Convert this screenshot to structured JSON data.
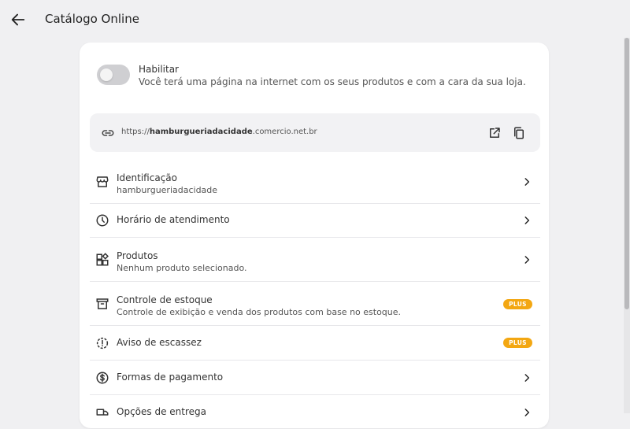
{
  "header": {
    "title": "Catálogo Online",
    "back_icon": "arrow-left-icon"
  },
  "enable": {
    "title": "Habilitar",
    "description": "Você terá uma página na internet com os seus produtos e com a cara da sua loja.",
    "enabled": false
  },
  "url": {
    "prefix": "https://",
    "domain": "hamburgueriadacidade",
    "suffix": ".comercio.net.br"
  },
  "menu": [
    {
      "label": "Identificação",
      "sub": "hamburgueriadacidade",
      "icon": "store-icon",
      "action": "chevron"
    },
    {
      "label": "Horário de atendimento",
      "sub": "",
      "icon": "clock-icon",
      "action": "chevron"
    },
    {
      "label": "Produtos",
      "sub": "Nenhum produto selecionado.",
      "icon": "category-icon",
      "action": "chevron"
    },
    {
      "label": "Controle de estoque",
      "sub": "Controle de exibição e venda dos produtos com base no estoque.",
      "icon": "archive-icon",
      "action": "badge",
      "badge": "PLUS"
    },
    {
      "label": "Aviso de escassez",
      "sub": "",
      "icon": "alert-badge-icon",
      "action": "badge",
      "badge": "PLUS"
    },
    {
      "label": "Formas de pagamento",
      "sub": "",
      "icon": "dollar-circle-icon",
      "action": "chevron"
    },
    {
      "label": "Opções de entrega",
      "sub": "",
      "icon": "delivery-icon",
      "action": "chevron"
    }
  ],
  "colors": {
    "background": "#f0f0f2",
    "card": "#ffffff",
    "badge": "#f3a712",
    "url_box": "#f2f2f4"
  }
}
